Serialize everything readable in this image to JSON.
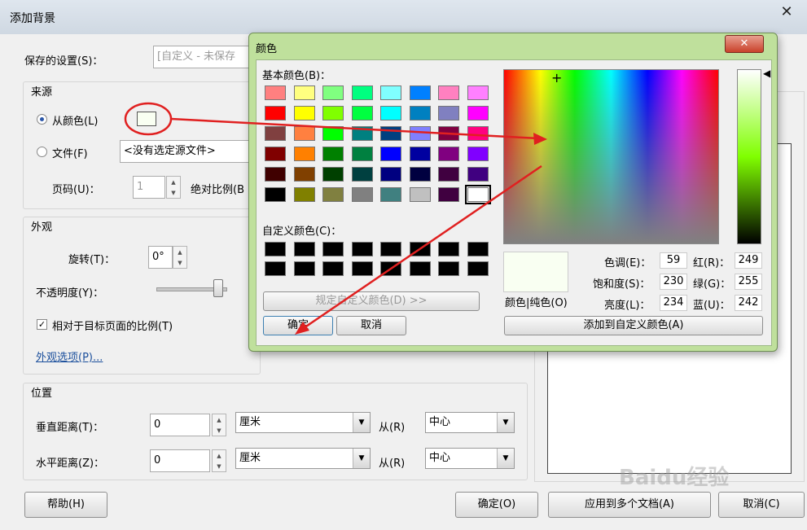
{
  "window": {
    "title": "添加背景",
    "close_symbol": "✕"
  },
  "saved_settings": {
    "label": "保存的设置(S)：",
    "value": "[自定义 - 未保存"
  },
  "source": {
    "title": "来源",
    "from_color": "从颜色(L)",
    "file": "文件(F)",
    "file_value": "<没有选定源文件>",
    "page_label": "页码(U)：",
    "page_value": "1",
    "absolute_scale": "绝对比例(B"
  },
  "appearance": {
    "title": "外观",
    "rotation_label": "旋转(T)：",
    "rotation_value": "0°",
    "opacity_label": "不透明度(Y)：",
    "opacity_level": 1.0,
    "relative_scale": "相对于目标页面的比例(T)",
    "options_link": "外观选项(P)..."
  },
  "position": {
    "title": "位置",
    "vertical_label": "垂直距离(T)：",
    "vertical_value": "0",
    "vertical_unit": "厘米",
    "vertical_from_label": "从(R)",
    "vertical_from": "中心",
    "horizontal_label": "水平距离(Z)：",
    "horizontal_value": "0",
    "horizontal_unit": "厘米",
    "horizontal_from_label": "从(R)",
    "horizontal_from": "中心"
  },
  "footer": {
    "help": "帮助(H)",
    "ok": "确定(O)",
    "apply_multiple": "应用到多个文档(A)",
    "cancel": "取消(C)"
  },
  "color_dialog": {
    "title": "颜色",
    "close_symbol": "✕",
    "basic_label": "基本颜色(B)：",
    "basic_colors": [
      [
        "#ff8080",
        "#ffff80",
        "#80ff80",
        "#00ff80",
        "#80ffff",
        "#0080ff",
        "#ff80c0",
        "#ff80ff"
      ],
      [
        "#ff0000",
        "#ffff00",
        "#80ff00",
        "#00ff40",
        "#00ffff",
        "#0080c0",
        "#8080c0",
        "#ff00ff"
      ],
      [
        "#804040",
        "#ff8040",
        "#00ff00",
        "#008080",
        "#004080",
        "#8080ff",
        "#800040",
        "#ff0080"
      ],
      [
        "#800000",
        "#ff8000",
        "#008000",
        "#008040",
        "#0000ff",
        "#0000a0",
        "#800080",
        "#8000ff"
      ],
      [
        "#400000",
        "#804000",
        "#004000",
        "#004040",
        "#000080",
        "#000040",
        "#400040",
        "#400080"
      ],
      [
        "#000000",
        "#808000",
        "#808040",
        "#808080",
        "#408080",
        "#c0c0c0",
        "#400040",
        "#ffffff"
      ]
    ],
    "custom_label": "自定义颜色(C)：",
    "define_custom": "规定自定义颜色(D) >>",
    "ok": "确定",
    "cancel": "取消",
    "color_solid_label": "颜色|纯色(O)",
    "selected_color": "#f9fff2",
    "hue_label": "色调(E)：",
    "hue": "59",
    "sat_label": "饱和度(S)：",
    "sat": "230",
    "lum_label": "亮度(L)：",
    "lum": "234",
    "red_label": "红(R)：",
    "red": "249",
    "green_label": "绿(G)：",
    "green": "255",
    "blue_label": "蓝(U)：",
    "blue": "242",
    "add_custom": "添加到自定义颜色(A)"
  },
  "watermark": "Baidu经验",
  "annotation_color": "#e02020"
}
